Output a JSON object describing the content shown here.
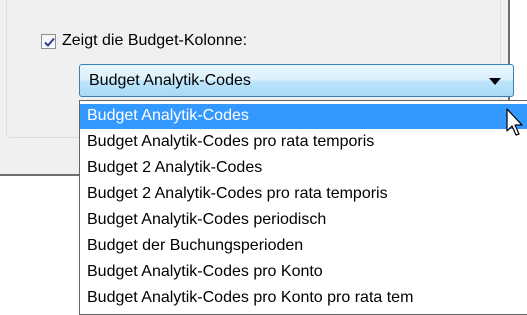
{
  "checkbox": {
    "label": "Zeigt die Budget-Kolonne:",
    "checked": true
  },
  "combo": {
    "selected_value": "Budget Analytik-Codes"
  },
  "dropdown": {
    "selected_index": 0,
    "options": [
      "Budget Analytik-Codes",
      "Budget Analytik-Codes pro rata temporis",
      "Budget 2 Analytik-Codes",
      "Budget 2 Analytik-Codes pro rata temporis",
      "Budget Analytik-Codes periodisch",
      "Budget der Buchungsperioden",
      "Budget Analytik-Codes pro Konto",
      "Budget Analytik-Codes pro Konto pro rata tem"
    ]
  },
  "colors": {
    "selection": "#3399ff",
    "combo_border": "#3c7fb1",
    "panel": "#f0f0f0"
  },
  "icons": {
    "combo_arrow": "chevron-down-icon",
    "check": "checkmark-icon",
    "pointer": "mouse-pointer-icon"
  }
}
